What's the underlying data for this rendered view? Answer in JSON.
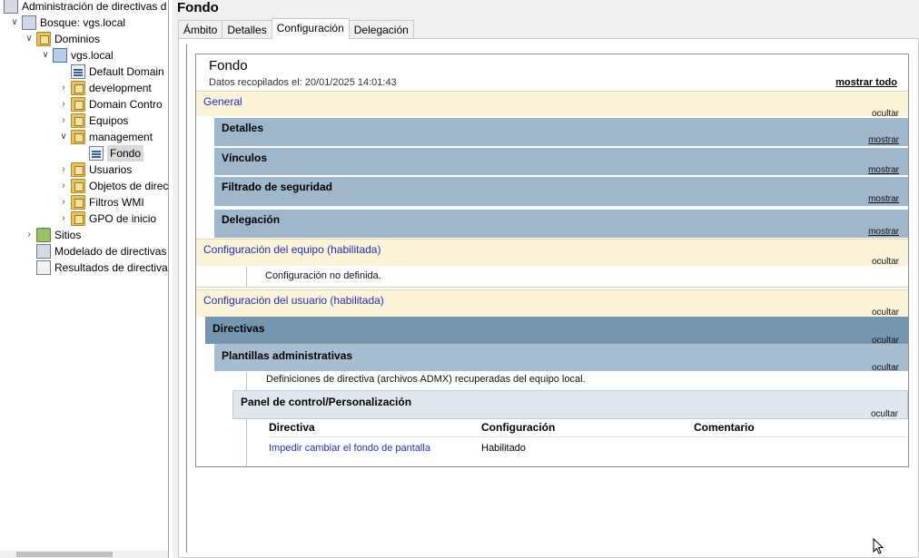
{
  "tree": {
    "items": [
      {
        "label": "Administración de directivas d",
        "icon": "gpmc-console-icon"
      },
      {
        "label": "Bosque: vgs.local",
        "icon": "forest-icon"
      },
      {
        "label": "Dominios",
        "icon": "domains-folder-icon"
      },
      {
        "label": "vgs.local",
        "icon": "domain-icon"
      },
      {
        "label": "Default Domain",
        "icon": "gpo-link-icon"
      },
      {
        "label": "development",
        "icon": "ou-folder-icon"
      },
      {
        "label": "Domain Contro",
        "icon": "ou-folder-icon"
      },
      {
        "label": "Equipos",
        "icon": "ou-folder-icon"
      },
      {
        "label": "management",
        "icon": "ou-folder-icon"
      },
      {
        "label": "Fondo",
        "icon": "gpo-link-icon"
      },
      {
        "label": "Usuarios",
        "icon": "ou-folder-icon"
      },
      {
        "label": "Objetos de direc",
        "icon": "gpo-container-icon"
      },
      {
        "label": "Filtros WMI",
        "icon": "wmi-folder-icon"
      },
      {
        "label": "GPO de inicio",
        "icon": "starter-gpo-folder-icon"
      },
      {
        "label": "Sitios",
        "icon": "sites-icon"
      },
      {
        "label": "Modelado de directivas",
        "icon": "modeling-icon"
      },
      {
        "label": "Resultados de directiva",
        "icon": "results-icon"
      }
    ]
  },
  "header": {
    "title": "Fondo"
  },
  "tabs": [
    {
      "label": "Ámbito"
    },
    {
      "label": "Detalles"
    },
    {
      "label": "Configuración",
      "active": true
    },
    {
      "label": "Delegación"
    }
  ],
  "report": {
    "title": "Fondo",
    "date": "Datos recopilados el: 20/01/2025 14:01:43",
    "show_all": "mostrar todo",
    "general": {
      "title": "General",
      "action": "ocultar"
    },
    "details": {
      "title": "Detalles",
      "action": "mostrar"
    },
    "links": {
      "title": "Vínculos",
      "action": "mostrar"
    },
    "security": {
      "title": "Filtrado de seguridad",
      "action": "mostrar"
    },
    "delegation": {
      "title": "Delegación",
      "action": "mostrar"
    },
    "computer": {
      "title": "Configuración del equipo (habilitada)",
      "action": "ocultar",
      "note": "Configuración no definida."
    },
    "user": {
      "title": "Configuración del usuario (habilitada)",
      "action": "ocultar"
    },
    "policies": {
      "title": "Directivas",
      "action": "ocultar"
    },
    "admin_templates": {
      "title": "Plantillas administrativas",
      "action": "ocultar",
      "note": "Definiciones de directiva (archivos ADMX) recuperadas del equipo local."
    },
    "panel": {
      "title": "Panel de control/Personalización",
      "action": "ocultar"
    },
    "table": {
      "headers": [
        "Directiva",
        "Configuración",
        "Comentario"
      ],
      "rows": [
        {
          "policy": "Impedir cambiar el fondo de pantalla",
          "setting": "Habilitado",
          "comment": ""
        }
      ]
    }
  },
  "colors": {
    "link": "#1f2ec0",
    "section_yellow": "#fbf4d8",
    "section_blue": "#9fb7cb",
    "section_dark": "#7596b0"
  }
}
